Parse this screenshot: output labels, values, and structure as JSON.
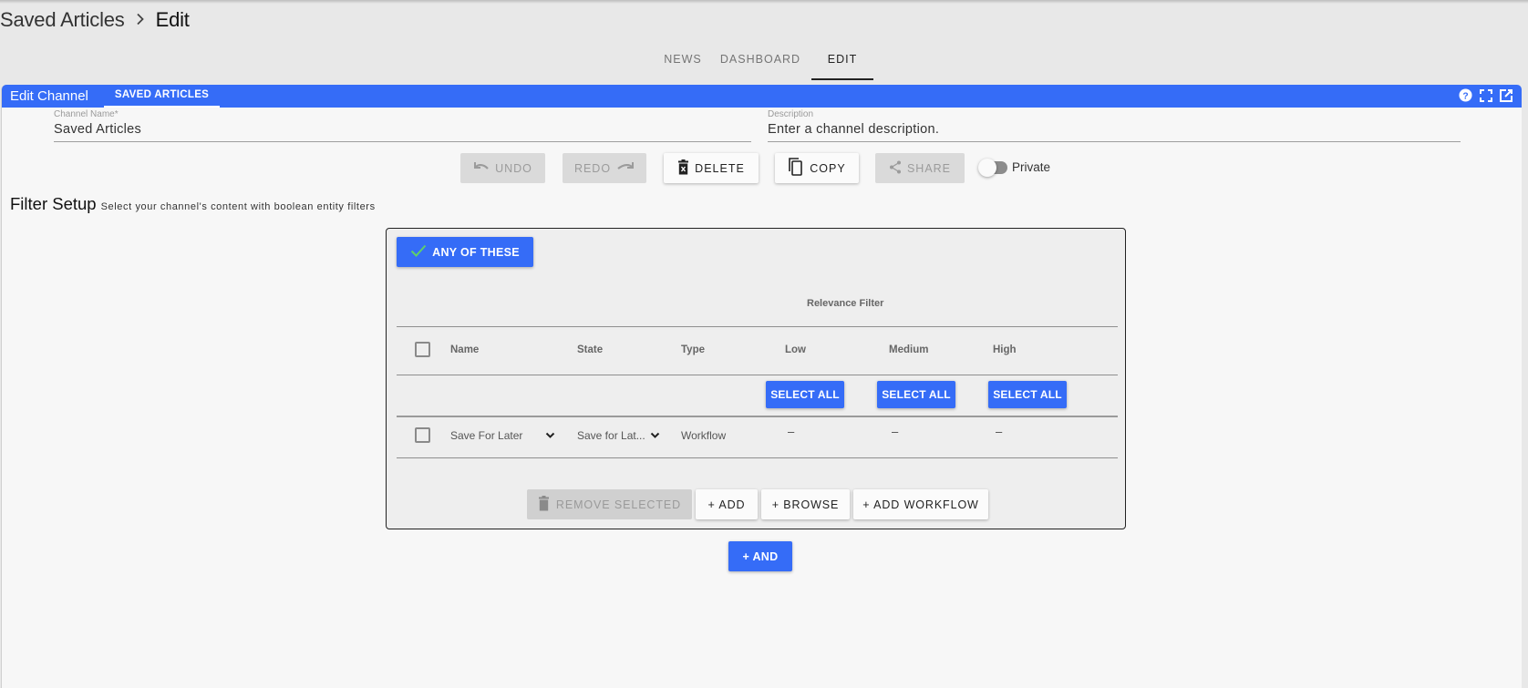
{
  "breadcrumb": {
    "items": [
      "Saved Articles",
      "Edit"
    ],
    "separator_icon": "chevron-right-icon"
  },
  "nav_tabs": [
    {
      "label": "NEWS",
      "active": false
    },
    {
      "label": "DASHBOARD",
      "active": false
    },
    {
      "label": "EDIT",
      "active": true
    }
  ],
  "panel": {
    "title": "Edit Channel",
    "tab_label": "SAVED ARTICLES",
    "header_icons": [
      "help-icon",
      "fullscreen-icon",
      "open-external-icon"
    ],
    "accent_color": "#356cf7"
  },
  "fields": {
    "channel_name": {
      "label": "Channel Name*",
      "value": "Saved Articles"
    },
    "description": {
      "label": "Description",
      "value": "Enter a channel description."
    }
  },
  "toolbar": {
    "undo": {
      "label": "UNDO",
      "icon": "undo-icon",
      "disabled": true
    },
    "redo": {
      "label": "REDO",
      "icon": "redo-icon",
      "disabled": true
    },
    "delete": {
      "label": "DELETE",
      "icon": "trash-icon",
      "disabled": false
    },
    "copy": {
      "label": "COPY",
      "icon": "copy-icon",
      "disabled": false
    },
    "share": {
      "label": "SHARE",
      "icon": "share-icon",
      "disabled": true
    },
    "private_toggle": {
      "label": "Private",
      "on": false
    }
  },
  "filter_setup": {
    "title": "Filter Setup",
    "subtitle": "Select your channel's content with boolean entity filters",
    "group": {
      "mode_label": "ANY OF THESE",
      "relevance_label": "Relevance Filter",
      "columns": [
        "Name",
        "State",
        "Type",
        "Low",
        "Medium",
        "High"
      ],
      "select_all_label": "SELECT ALL",
      "rows": [
        {
          "name": "Save For Later",
          "state": "Save for Lat...",
          "type": "Workflow",
          "low": "–",
          "medium": "–",
          "high": "–",
          "checked": false
        }
      ],
      "actions": {
        "remove_selected": "REMOVE SELECTED",
        "add": "+ ADD",
        "browse": "+ BROWSE",
        "add_workflow": "+ ADD WORKFLOW"
      }
    },
    "and_label": "+ AND"
  }
}
